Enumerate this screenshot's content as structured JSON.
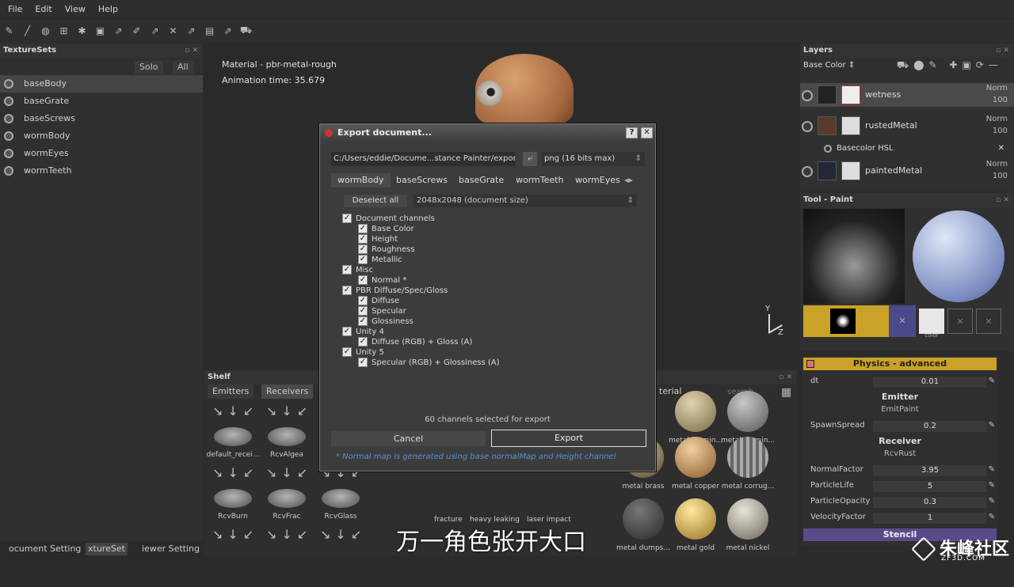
{
  "menu": [
    "File",
    "Edit",
    "View",
    "Help"
  ],
  "texturesets": {
    "title": "TextureSets",
    "solo": "Solo",
    "all": "All",
    "items": [
      "baseBody",
      "baseGrate",
      "baseScrews",
      "wormBody",
      "wormEyes",
      "wormTeeth"
    ]
  },
  "viewport": {
    "material": "Material - pbr-metal-rough",
    "animation": "Animation time: 35.679",
    "gizmo_y": "Y",
    "gizmo_z": "Z"
  },
  "shelf": {
    "title": "Shelf",
    "tabs": [
      "Emitters",
      "Receivers"
    ],
    "mat_tab": "terial",
    "search": "search",
    "items": [
      "default_recei...",
      "RcvAlgea",
      "",
      "RcvBurn",
      "RcvFrac",
      "RcvGlass"
    ],
    "materials": [
      "metal alumin...",
      "metal alumin...",
      "metal brass",
      "metal copper",
      "metal corrug...",
      "metal dumps...",
      "metal gold",
      "metal nickel"
    ],
    "bottom_labels": [
      "fracture",
      "heavy leaking",
      "laser impact"
    ]
  },
  "bottom_tabs": [
    "ocument Setting",
    "xtureSet",
    "iewer Setting"
  ],
  "layers": {
    "title": "Layers",
    "channel": "Base Color",
    "rows": [
      {
        "name": "wetness",
        "blend": "Norm",
        "opacity": "100"
      },
      {
        "name": "rustedMetal",
        "blend": "Norm",
        "opacity": "100"
      },
      {
        "name": "paintedMetal",
        "blend": "Norm",
        "opacity": "100"
      }
    ],
    "effect": "Basecolor HSL"
  },
  "tool": {
    "title": "Tool - Paint",
    "swatch_label": "color"
  },
  "physics": {
    "header": "Physics - advanced",
    "dt_label": "dt",
    "dt": "0.01",
    "emitter": "Emitter",
    "emitter_name": "EmitPaint",
    "spawn_label": "SpawnSpread",
    "spawn": "0.2",
    "receiver": "Receiver",
    "receiver_name": "RcvRust",
    "params": [
      {
        "k": "NormalFactor",
        "v": "3.95"
      },
      {
        "k": "ParticleLife",
        "v": "5"
      },
      {
        "k": "ParticleOpacity",
        "v": "0.3"
      },
      {
        "k": "VelocityFactor",
        "v": "1"
      }
    ],
    "stencil": "Stencil"
  },
  "dialog": {
    "title": "Export document...",
    "help": "?",
    "close": "✕",
    "path": "C:/Users/eddie/Docume...stance Painter/export",
    "format": "png (16 bits max)",
    "tabs": [
      "wormBody",
      "baseScrews",
      "baseGrate",
      "wormTeeth",
      "wormEyes"
    ],
    "deselect": "Deselect all",
    "size": "2048x2048 (document size)",
    "channels": [
      {
        "label": "Document channels",
        "lvl": 0
      },
      {
        "label": "Base Color",
        "lvl": 1
      },
      {
        "label": "Height",
        "lvl": 1
      },
      {
        "label": "Roughness",
        "lvl": 1
      },
      {
        "label": "Metallic",
        "lvl": 1
      },
      {
        "label": "Misc",
        "lvl": 0
      },
      {
        "label": "Normal *",
        "lvl": 1
      },
      {
        "label": "PBR Diffuse/Spec/Gloss",
        "lvl": 0
      },
      {
        "label": "Diffuse",
        "lvl": 1
      },
      {
        "label": "Specular",
        "lvl": 1
      },
      {
        "label": "Glossiness",
        "lvl": 1
      },
      {
        "label": "Unity 4",
        "lvl": 0
      },
      {
        "label": "Diffuse (RGB) + Gloss (A)",
        "lvl": 1
      },
      {
        "label": "Unity 5",
        "lvl": 0
      },
      {
        "label": "Specular (RGB) + Glossiness (A)",
        "lvl": 1
      }
    ],
    "selected_count": "60 channels selected for export",
    "cancel": "Cancel",
    "export": "Export",
    "note": "* Normal map is generated using base normalMap and Height channel"
  },
  "subtitle": "万一角色张开大口",
  "watermark": {
    "main": "朱峰社区",
    "sub": "ZF3D.COM"
  },
  "colors": {
    "physics_header": "#c9a227",
    "stencil": "#5a4a8a",
    "note": "#5b8fd6"
  }
}
